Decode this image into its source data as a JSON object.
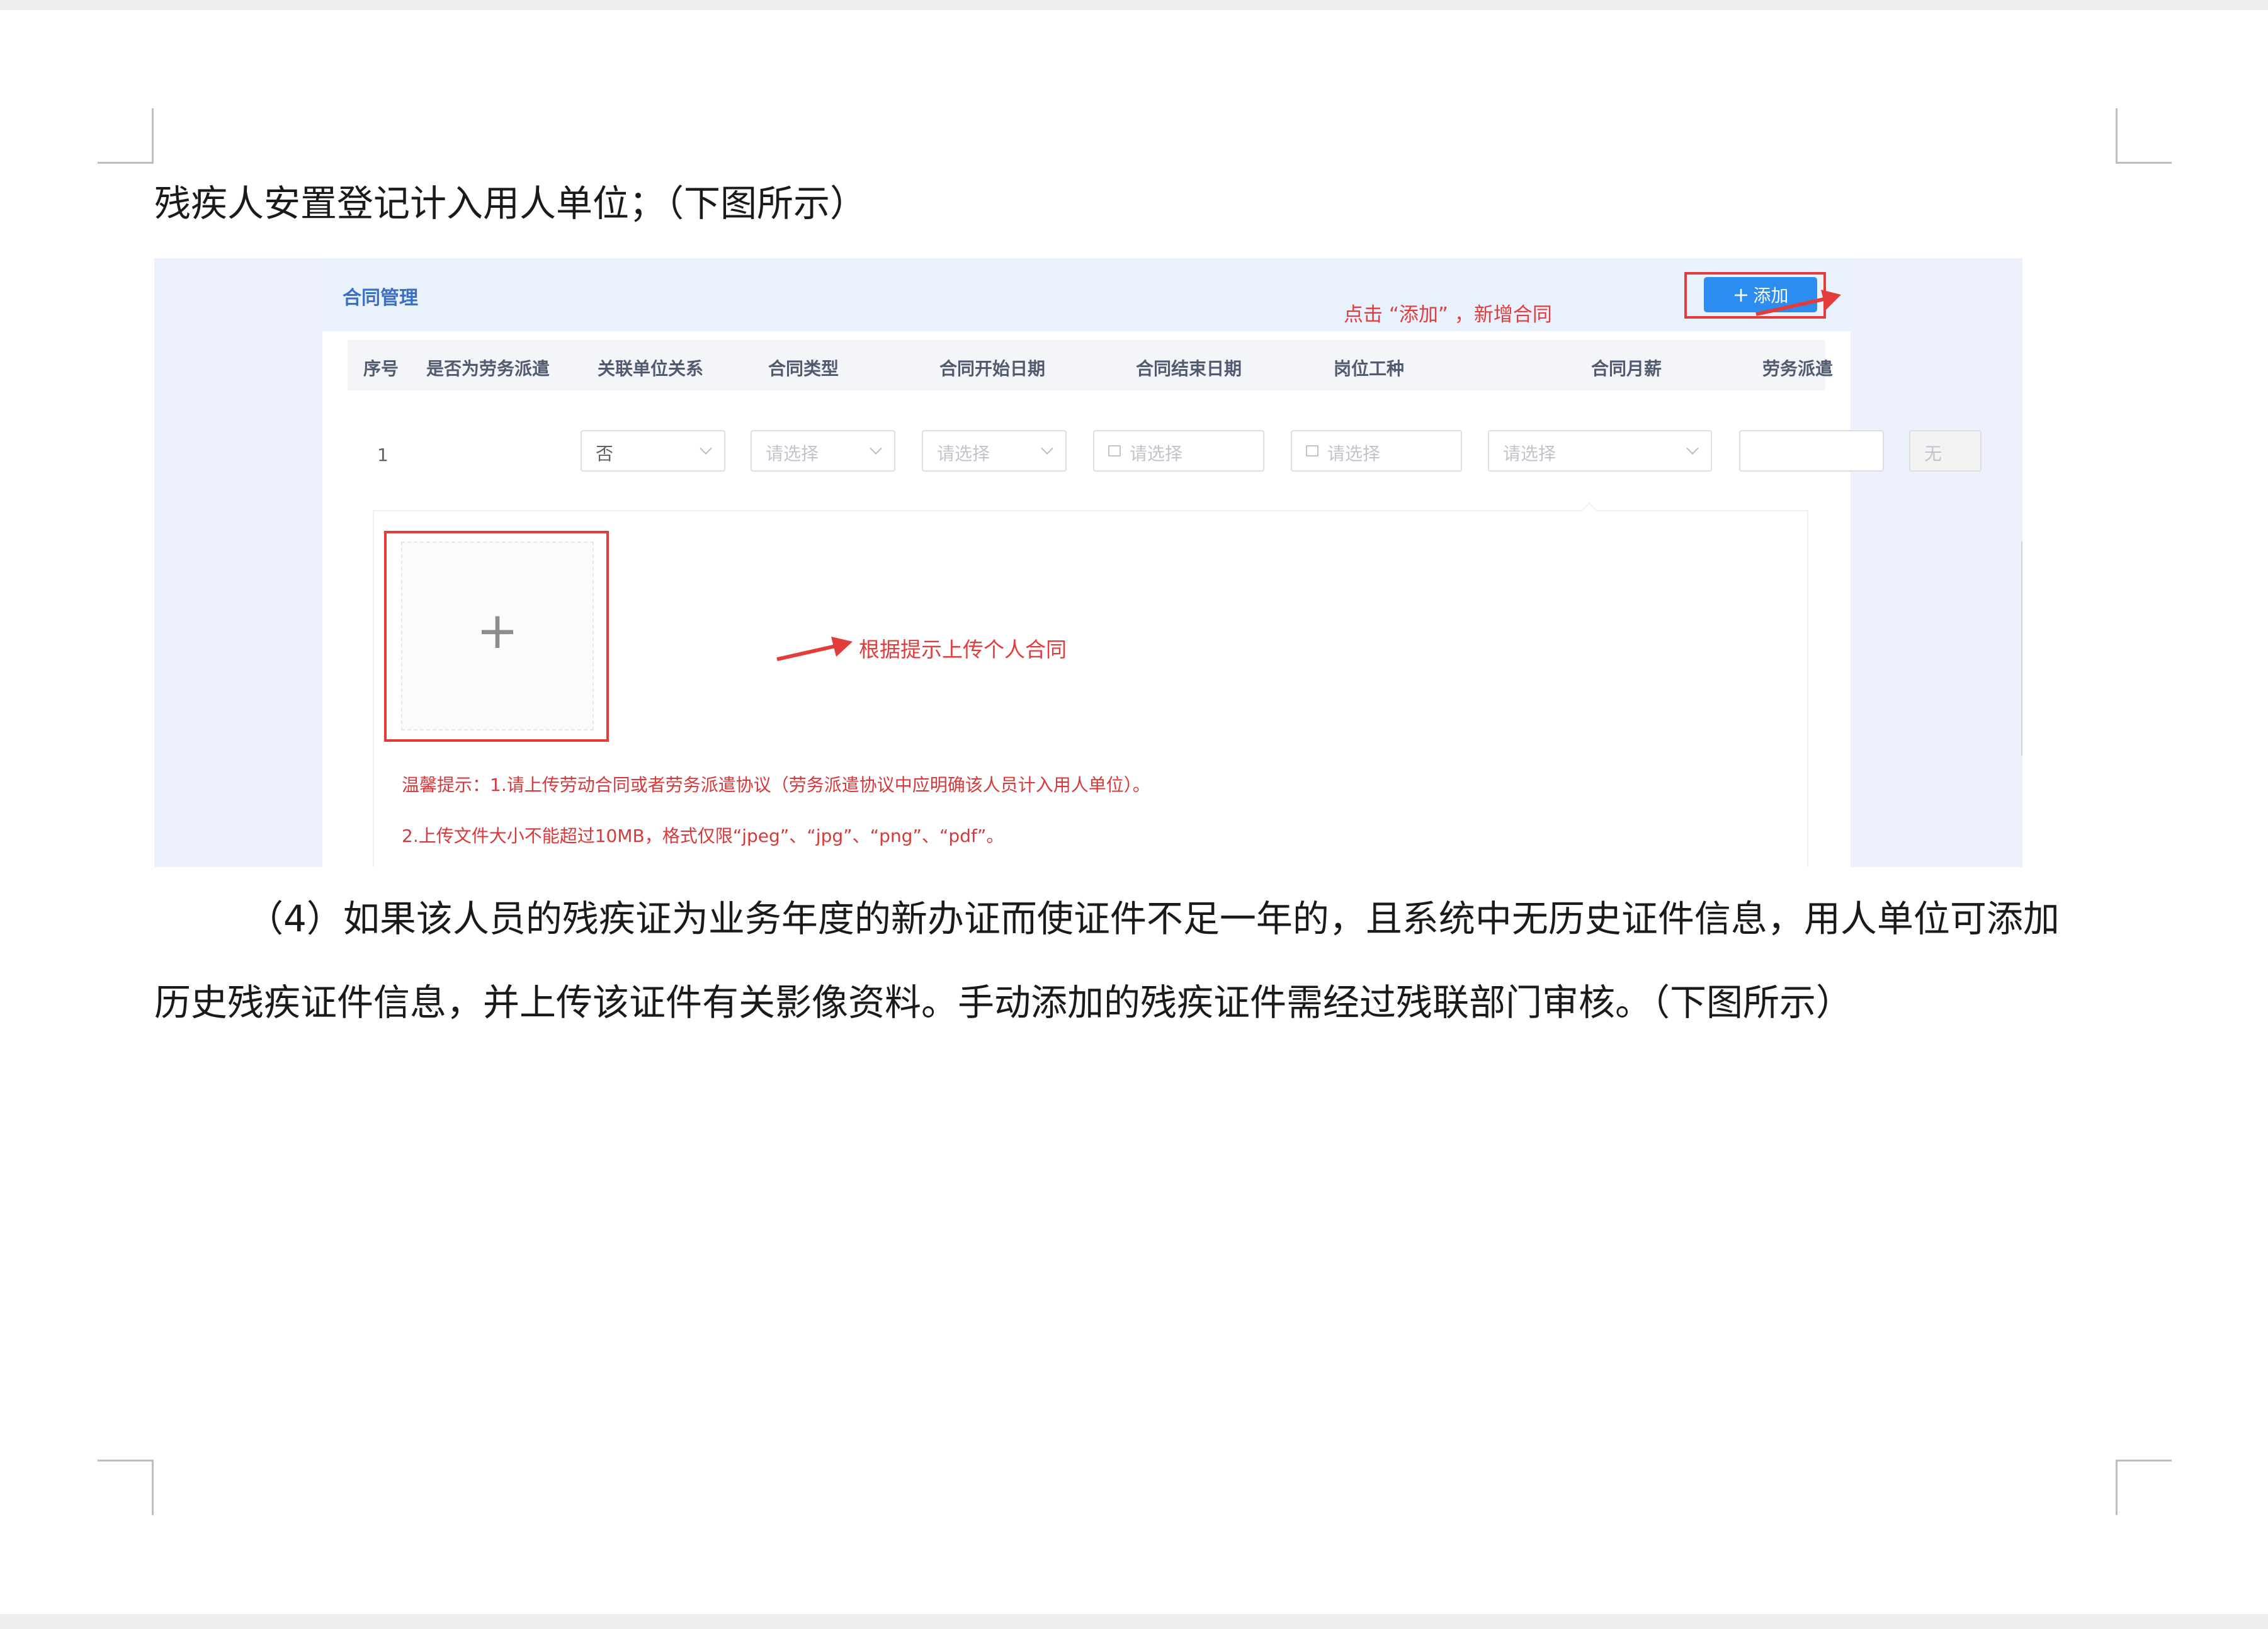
{
  "doc": {
    "intro_line": "残疾人安置登记计入用人单位；（下图所示）",
    "paragraph_line1": "（4）如果该人员的残疾证为业务年度的新办证而使证件不足一年的，且系统中无历史证件信息，用人单位可添加",
    "paragraph_line2": "历史残疾证件信息，并上传该证件有关影像资料。手动添加的残疾证件需经过残联部门审核。（下图所示）"
  },
  "screenshot": {
    "panel_title": "合同管理",
    "callout_add": "点击 “添加” ，新增合同",
    "add_button": {
      "icon": "plus-icon",
      "label": "添加"
    },
    "columns": [
      "序号",
      "是否为劳务派遣",
      "关联单位关系",
      "合同类型",
      "合同开始日期",
      "合同结束日期",
      "岗位工种",
      "合同月薪",
      "劳务派遣"
    ],
    "row": {
      "index": "1",
      "labor_dispatch": "否",
      "unit_relation_placeholder": "请选择",
      "contract_type_placeholder": "请选择",
      "start_date_placeholder": "请选择",
      "end_date_placeholder": "请选择",
      "job_type_placeholder": "请选择",
      "monthly_salary": "",
      "dispatch_value": "无"
    },
    "upload_plus": "+",
    "upload_annotation": "根据提示上传个人合同",
    "tip_line1": "温馨提示：1.请上传劳动合同或者劳务派遣协议（劳务派遣协议中应明确该人员计入用人单位）。",
    "tip_line2": "2.上传文件大小不能超过10MB，格式仅限“jpeg”、“jpg”、“png”、“pdf”。",
    "colors": {
      "annotation_red": "#e23c3c",
      "primary_blue": "#2d8cf0",
      "title_blue": "#3d6ec5"
    }
  }
}
